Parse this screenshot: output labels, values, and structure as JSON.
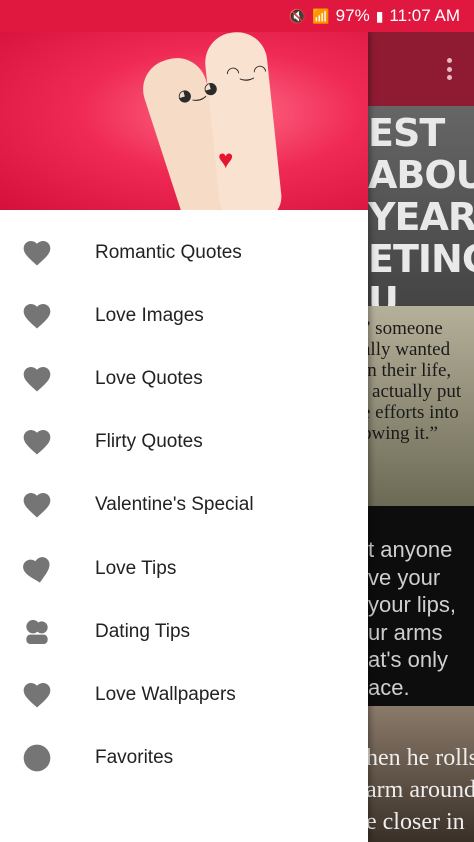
{
  "status_bar": {
    "battery": "97%",
    "time": "11:07 AM"
  },
  "colors": {
    "accent": "#e0183f",
    "toolbar": "#8f1b33",
    "icon_gray": "#757575"
  },
  "menu": {
    "items": [
      {
        "label": "Romantic Quotes",
        "icon": "heart-icon"
      },
      {
        "label": "Love Images",
        "icon": "heart-icon"
      },
      {
        "label": "Love Quotes",
        "icon": "heart-icon"
      },
      {
        "label": "Flirty Quotes",
        "icon": "heart-icon"
      },
      {
        "label": "Valentine's Special",
        "icon": "heart-icon"
      },
      {
        "label": "Love Tips",
        "icon": "heart-tilted-icon"
      },
      {
        "label": "Dating Tips",
        "icon": "couple-icon"
      },
      {
        "label": "Love Wallpapers",
        "icon": "heart-icon"
      },
      {
        "label": "Favorites",
        "icon": "circle-icon"
      }
    ]
  },
  "background_cards": [
    {
      "lines": [
        "EST",
        "ABOUT",
        "YEAR",
        "ETING",
        "U."
      ]
    },
    {
      "lines": [
        "” someone",
        "ally wanted",
        "in their life,",
        "l actually put",
        "e efforts into",
        "owing it.”"
      ]
    },
    {
      "lines": [
        "t anyone",
        "ve your",
        "your lips,",
        "ur arms",
        "at's only",
        "ace."
      ]
    },
    {
      "lines": [
        "hen he rolls",
        "arm around",
        "e closer in"
      ]
    }
  ]
}
